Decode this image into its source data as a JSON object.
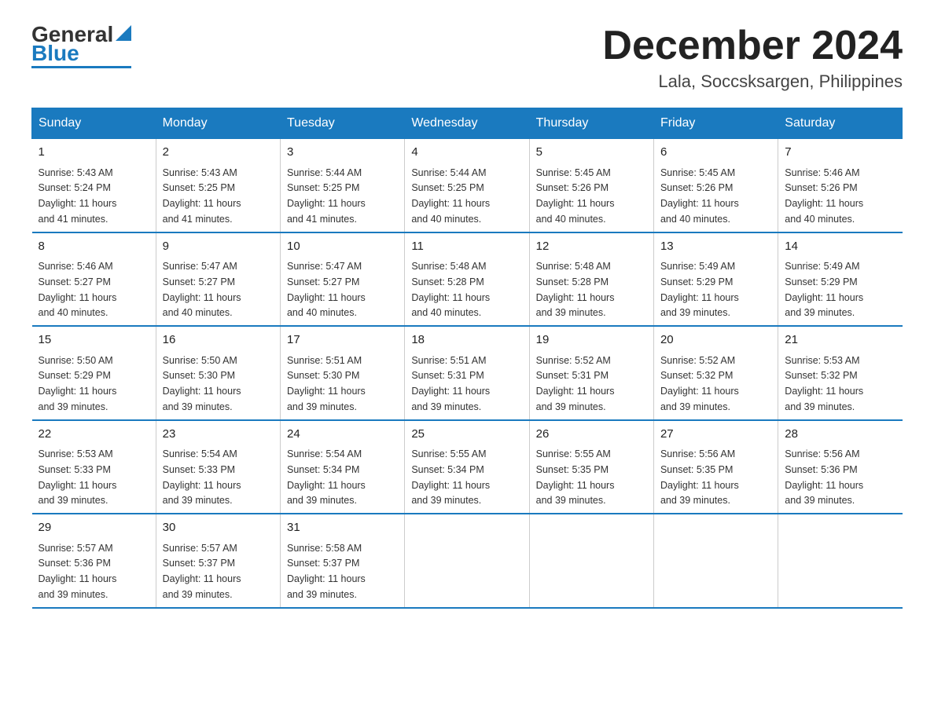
{
  "logo": {
    "general": "General",
    "blue": "Blue"
  },
  "title": "December 2024",
  "subtitle": "Lala, Soccsksargen, Philippines",
  "days_header": [
    "Sunday",
    "Monday",
    "Tuesday",
    "Wednesday",
    "Thursday",
    "Friday",
    "Saturday"
  ],
  "weeks": [
    [
      {
        "day": "1",
        "info": "Sunrise: 5:43 AM\nSunset: 5:24 PM\nDaylight: 11 hours\nand 41 minutes."
      },
      {
        "day": "2",
        "info": "Sunrise: 5:43 AM\nSunset: 5:25 PM\nDaylight: 11 hours\nand 41 minutes."
      },
      {
        "day": "3",
        "info": "Sunrise: 5:44 AM\nSunset: 5:25 PM\nDaylight: 11 hours\nand 41 minutes."
      },
      {
        "day": "4",
        "info": "Sunrise: 5:44 AM\nSunset: 5:25 PM\nDaylight: 11 hours\nand 40 minutes."
      },
      {
        "day": "5",
        "info": "Sunrise: 5:45 AM\nSunset: 5:26 PM\nDaylight: 11 hours\nand 40 minutes."
      },
      {
        "day": "6",
        "info": "Sunrise: 5:45 AM\nSunset: 5:26 PM\nDaylight: 11 hours\nand 40 minutes."
      },
      {
        "day": "7",
        "info": "Sunrise: 5:46 AM\nSunset: 5:26 PM\nDaylight: 11 hours\nand 40 minutes."
      }
    ],
    [
      {
        "day": "8",
        "info": "Sunrise: 5:46 AM\nSunset: 5:27 PM\nDaylight: 11 hours\nand 40 minutes."
      },
      {
        "day": "9",
        "info": "Sunrise: 5:47 AM\nSunset: 5:27 PM\nDaylight: 11 hours\nand 40 minutes."
      },
      {
        "day": "10",
        "info": "Sunrise: 5:47 AM\nSunset: 5:27 PM\nDaylight: 11 hours\nand 40 minutes."
      },
      {
        "day": "11",
        "info": "Sunrise: 5:48 AM\nSunset: 5:28 PM\nDaylight: 11 hours\nand 40 minutes."
      },
      {
        "day": "12",
        "info": "Sunrise: 5:48 AM\nSunset: 5:28 PM\nDaylight: 11 hours\nand 39 minutes."
      },
      {
        "day": "13",
        "info": "Sunrise: 5:49 AM\nSunset: 5:29 PM\nDaylight: 11 hours\nand 39 minutes."
      },
      {
        "day": "14",
        "info": "Sunrise: 5:49 AM\nSunset: 5:29 PM\nDaylight: 11 hours\nand 39 minutes."
      }
    ],
    [
      {
        "day": "15",
        "info": "Sunrise: 5:50 AM\nSunset: 5:29 PM\nDaylight: 11 hours\nand 39 minutes."
      },
      {
        "day": "16",
        "info": "Sunrise: 5:50 AM\nSunset: 5:30 PM\nDaylight: 11 hours\nand 39 minutes."
      },
      {
        "day": "17",
        "info": "Sunrise: 5:51 AM\nSunset: 5:30 PM\nDaylight: 11 hours\nand 39 minutes."
      },
      {
        "day": "18",
        "info": "Sunrise: 5:51 AM\nSunset: 5:31 PM\nDaylight: 11 hours\nand 39 minutes."
      },
      {
        "day": "19",
        "info": "Sunrise: 5:52 AM\nSunset: 5:31 PM\nDaylight: 11 hours\nand 39 minutes."
      },
      {
        "day": "20",
        "info": "Sunrise: 5:52 AM\nSunset: 5:32 PM\nDaylight: 11 hours\nand 39 minutes."
      },
      {
        "day": "21",
        "info": "Sunrise: 5:53 AM\nSunset: 5:32 PM\nDaylight: 11 hours\nand 39 minutes."
      }
    ],
    [
      {
        "day": "22",
        "info": "Sunrise: 5:53 AM\nSunset: 5:33 PM\nDaylight: 11 hours\nand 39 minutes."
      },
      {
        "day": "23",
        "info": "Sunrise: 5:54 AM\nSunset: 5:33 PM\nDaylight: 11 hours\nand 39 minutes."
      },
      {
        "day": "24",
        "info": "Sunrise: 5:54 AM\nSunset: 5:34 PM\nDaylight: 11 hours\nand 39 minutes."
      },
      {
        "day": "25",
        "info": "Sunrise: 5:55 AM\nSunset: 5:34 PM\nDaylight: 11 hours\nand 39 minutes."
      },
      {
        "day": "26",
        "info": "Sunrise: 5:55 AM\nSunset: 5:35 PM\nDaylight: 11 hours\nand 39 minutes."
      },
      {
        "day": "27",
        "info": "Sunrise: 5:56 AM\nSunset: 5:35 PM\nDaylight: 11 hours\nand 39 minutes."
      },
      {
        "day": "28",
        "info": "Sunrise: 5:56 AM\nSunset: 5:36 PM\nDaylight: 11 hours\nand 39 minutes."
      }
    ],
    [
      {
        "day": "29",
        "info": "Sunrise: 5:57 AM\nSunset: 5:36 PM\nDaylight: 11 hours\nand 39 minutes."
      },
      {
        "day": "30",
        "info": "Sunrise: 5:57 AM\nSunset: 5:37 PM\nDaylight: 11 hours\nand 39 minutes."
      },
      {
        "day": "31",
        "info": "Sunrise: 5:58 AM\nSunset: 5:37 PM\nDaylight: 11 hours\nand 39 minutes."
      },
      {
        "day": "",
        "info": ""
      },
      {
        "day": "",
        "info": ""
      },
      {
        "day": "",
        "info": ""
      },
      {
        "day": "",
        "info": ""
      }
    ]
  ]
}
